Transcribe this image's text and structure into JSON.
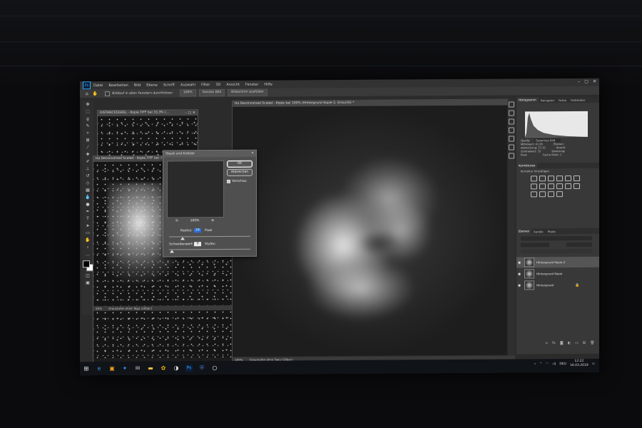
{
  "menubar": {
    "logo": "Ps",
    "items": [
      "Datei",
      "Bearbeiten",
      "Bild",
      "Ebene",
      "Schrift",
      "Auswahl",
      "Filter",
      "3D",
      "Ansicht",
      "Fenster",
      "Hilfe"
    ]
  },
  "options_bar": {
    "checkbox_label": "Bildlauf in allen Fenstern durchführen",
    "zoom": "100%",
    "fit_screen": "Ganzes Bild",
    "fill_screen": "Bildschirm ausfüllen"
  },
  "doc_top": {
    "title": "DISTANCEDGREL - Kopie.TIFF bei 33,3% (...",
    "status": ""
  },
  "doc_left": {
    "title": "Ha Deconvolved Scaled - Kopie.TIFF bei 33,3% ...",
    "status_zoom": "50%",
    "status_text": "Graustufen ohne Tagu (16bpc)"
  },
  "doc_main": {
    "title": "Ha Deconvolved Scaled - Kopie bei 100% (Hintergrund Kopie 2, Grau/16) *",
    "status_zoom": "100%",
    "status_text": "Graustufen ohne Tagu (16bpc)"
  },
  "dialog": {
    "title": "Staub und Kratzer",
    "ok": "OK",
    "cancel": "Abbrechen",
    "preview_label": "Vorschau",
    "preview_checked": "✓",
    "zoom": "100%",
    "radius_label": "Radius:",
    "radius_value": "24",
    "radius_unit": "Pixel",
    "threshold_label": "Schwellenwert:",
    "threshold_value": "3",
    "threshold_unit": "Stufen"
  },
  "right_panel": {
    "tabs_top": [
      "Histogramm",
      "Navigator",
      "Farbe",
      "Farbfelder"
    ],
    "source_label": "Quelle:",
    "source_value": "Gesamtes Bild",
    "stats": [
      [
        "Mittelwert:",
        "41,26",
        "Ebenen:",
        ""
      ],
      [
        "Abweichung:",
        "27,32",
        "Anzahl:",
        ""
      ],
      [
        "Zentralwert:",
        "33",
        "Spreizung:",
        ""
      ],
      [
        "Pixel:",
        "",
        "Cache-Stufe:",
        "1"
      ]
    ],
    "adjust_tab": "Korrekturen",
    "adjust_add": "Korrektur hinzufügen",
    "layers_tabs": [
      "Ebenen",
      "Kanäle",
      "Pfade"
    ],
    "layers": [
      {
        "name": "Hintergrund Kopie 2"
      },
      {
        "name": "Hintergrund Kopie"
      },
      {
        "name": "Hintergrund"
      }
    ]
  },
  "taskbar": {
    "time": "12:22",
    "date": "16.03.2019",
    "lang": "DEU"
  }
}
